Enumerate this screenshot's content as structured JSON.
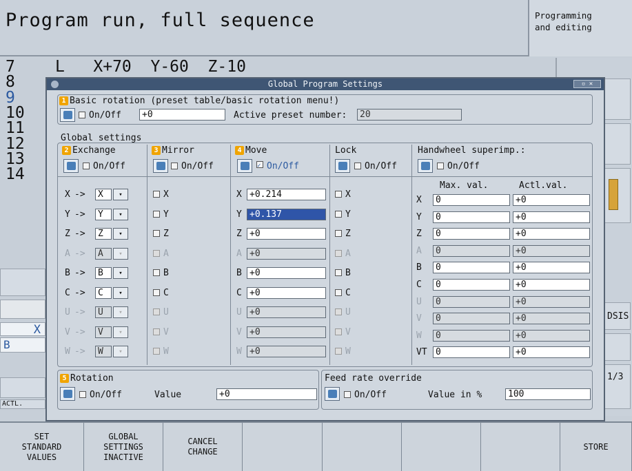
{
  "header": {
    "mode_title": "Program run, full sequence",
    "switch_mode": "Programming\nand editing"
  },
  "program_lines": [
    {
      "n": "7",
      "text": "L   X+70  Y-60  Z-10",
      "dim": false
    },
    {
      "n": "8",
      "text": "",
      "dim": false
    },
    {
      "n": "9",
      "text": "",
      "dim": true
    },
    {
      "n": "10",
      "text": "",
      "dim": false
    },
    {
      "n": "11",
      "text": "",
      "dim": false
    },
    {
      "n": "12",
      "text": "",
      "dim": false
    },
    {
      "n": "13",
      "text": "",
      "dim": false
    },
    {
      "n": "14",
      "text": "",
      "dim": false
    }
  ],
  "right_panel": {
    "label_dsis": "DSIS",
    "label_page": "1/3"
  },
  "left_strip": {
    "axis_x": "X",
    "axis_b": "B",
    "actl": "ACTL."
  },
  "dialog": {
    "title": "Global Program Settings",
    "basic_rotation": {
      "num": "1",
      "title": "Basic rotation (preset table/basic rotation menu!)",
      "onoff": "On/Off",
      "value": "+0",
      "preset_label": "Active preset number:",
      "preset_value": "20"
    },
    "global_settings_label": "Global settings",
    "exchange": {
      "num": "2",
      "title": "Exchange",
      "onoff": "On/Off",
      "rows": [
        {
          "axis": "X",
          "value": "X",
          "dim": false
        },
        {
          "axis": "Y",
          "value": "Y",
          "dim": false
        },
        {
          "axis": "Z",
          "value": "Z",
          "dim": false
        },
        {
          "axis": "A",
          "value": "A",
          "dim": true
        },
        {
          "axis": "B",
          "value": "B",
          "dim": false
        },
        {
          "axis": "C",
          "value": "C",
          "dim": false
        },
        {
          "axis": "U",
          "value": "U",
          "dim": true
        },
        {
          "axis": "V",
          "value": "V",
          "dim": true
        },
        {
          "axis": "W",
          "value": "W",
          "dim": true
        }
      ]
    },
    "mirror": {
      "num": "3",
      "title": "Mirror",
      "onoff": "On/Off",
      "rows": [
        {
          "axis": "X",
          "dim": false
        },
        {
          "axis": "Y",
          "dim": false
        },
        {
          "axis": "Z",
          "dim": false
        },
        {
          "axis": "A",
          "dim": true
        },
        {
          "axis": "B",
          "dim": false
        },
        {
          "axis": "C",
          "dim": false
        },
        {
          "axis": "U",
          "dim": true
        },
        {
          "axis": "V",
          "dim": true
        },
        {
          "axis": "W",
          "dim": true
        }
      ]
    },
    "move": {
      "num": "4",
      "title": "Move",
      "onoff": "On/Off",
      "checked": true,
      "rows": [
        {
          "axis": "X",
          "value": "+0.214",
          "dim": false,
          "sel": false
        },
        {
          "axis": "Y",
          "value": "+0.137",
          "dim": false,
          "sel": true
        },
        {
          "axis": "Z",
          "value": "+0",
          "dim": false,
          "sel": false
        },
        {
          "axis": "A",
          "value": "+0",
          "dim": true,
          "sel": false
        },
        {
          "axis": "B",
          "value": "+0",
          "dim": false,
          "sel": false
        },
        {
          "axis": "C",
          "value": "+0",
          "dim": false,
          "sel": false
        },
        {
          "axis": "U",
          "value": "+0",
          "dim": true,
          "sel": false
        },
        {
          "axis": "V",
          "value": "+0",
          "dim": true,
          "sel": false
        },
        {
          "axis": "W",
          "value": "+0",
          "dim": true,
          "sel": false
        }
      ]
    },
    "lock": {
      "title": "Lock",
      "onoff": "On/Off",
      "rows": [
        {
          "axis": "X",
          "dim": false
        },
        {
          "axis": "Y",
          "dim": false
        },
        {
          "axis": "Z",
          "dim": false
        },
        {
          "axis": "A",
          "dim": true
        },
        {
          "axis": "B",
          "dim": false
        },
        {
          "axis": "C",
          "dim": false
        },
        {
          "axis": "U",
          "dim": true
        },
        {
          "axis": "V",
          "dim": true
        },
        {
          "axis": "W",
          "dim": true
        }
      ]
    },
    "handwheel": {
      "title": "Handwheel superimp.:",
      "onoff": "On/Off",
      "col_max": "Max. val.",
      "col_act": "Actl.val.",
      "rows": [
        {
          "axis": "X",
          "max": "0",
          "act": "+0",
          "dim": false
        },
        {
          "axis": "Y",
          "max": "0",
          "act": "+0",
          "dim": false
        },
        {
          "axis": "Z",
          "max": "0",
          "act": "+0",
          "dim": false
        },
        {
          "axis": "A",
          "max": "0",
          "act": "+0",
          "dim": true
        },
        {
          "axis": "B",
          "max": "0",
          "act": "+0",
          "dim": false
        },
        {
          "axis": "C",
          "max": "0",
          "act": "+0",
          "dim": false
        },
        {
          "axis": "U",
          "max": "0",
          "act": "+0",
          "dim": true
        },
        {
          "axis": "V",
          "max": "0",
          "act": "+0",
          "dim": true
        },
        {
          "axis": "W",
          "max": "0",
          "act": "+0",
          "dim": true
        },
        {
          "axis": "VT",
          "max": "0",
          "act": "+0",
          "dim": false
        }
      ]
    },
    "rotation": {
      "num": "5",
      "title": "Rotation",
      "onoff": "On/Off",
      "value_label": "Value",
      "value": "+0"
    },
    "feed": {
      "title": "Feed rate override",
      "onoff": "On/Off",
      "value_label": "Value in %",
      "value": "100"
    }
  },
  "softkeys": [
    {
      "label": "SET\nSTANDARD\nVALUES"
    },
    {
      "label": "GLOBAL\nSETTINGS\nINACTIVE"
    },
    {
      "label": "CANCEL\nCHANGE"
    },
    {
      "label": ""
    },
    {
      "label": ""
    },
    {
      "label": ""
    },
    {
      "label": ""
    },
    {
      "label": "STORE"
    }
  ]
}
